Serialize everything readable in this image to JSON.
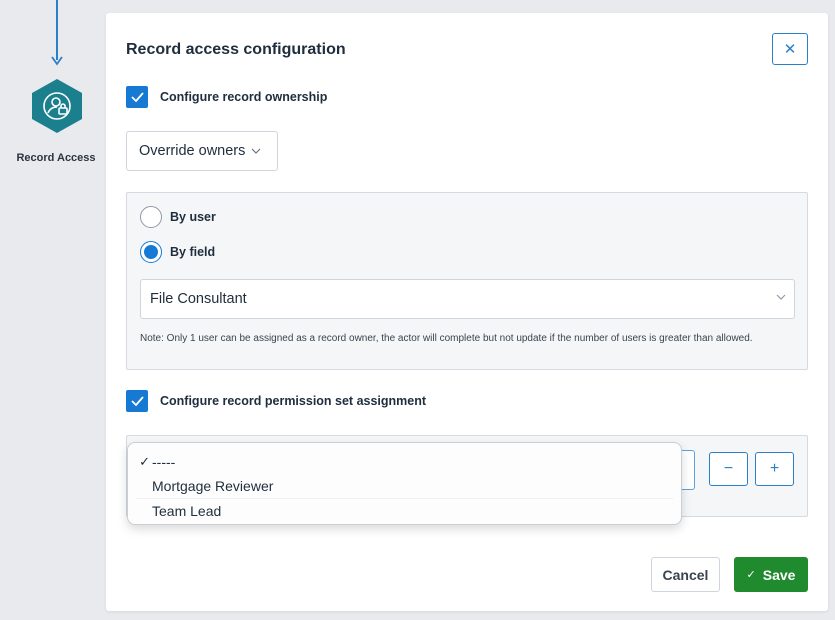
{
  "canvas": {
    "node_label": "Record Access",
    "node_icon": "user-lock-icon",
    "accent": "#1b7f8e"
  },
  "modal": {
    "title": "Record access configuration",
    "close_icon": "close-icon",
    "ownership": {
      "checked": true,
      "label": "Configure record ownership",
      "mode_select": {
        "value": "Override owners"
      },
      "radios": [
        {
          "label": "By user",
          "selected": false
        },
        {
          "label": "By field",
          "selected": true
        }
      ],
      "field_select": {
        "value": "File Consultant"
      },
      "note": "Note: Only 1 user can be assigned as a record owner, the actor will complete but not update if the number of users is greater than allowed."
    },
    "permissions": {
      "checked": true,
      "label": "Configure record permission set assignment",
      "remove_label": "−",
      "add_label": "+",
      "dropdown": {
        "selected_mark": "✓",
        "options": [
          {
            "label": "-----",
            "selected": true
          },
          {
            "label": "Mortgage Reviewer",
            "selected": false
          },
          {
            "label": "Team Lead",
            "selected": false
          }
        ]
      }
    },
    "footer": {
      "cancel_label": "Cancel",
      "save_label": "Save",
      "save_icon": "check-icon",
      "save_color": "#1f8a2e"
    }
  }
}
